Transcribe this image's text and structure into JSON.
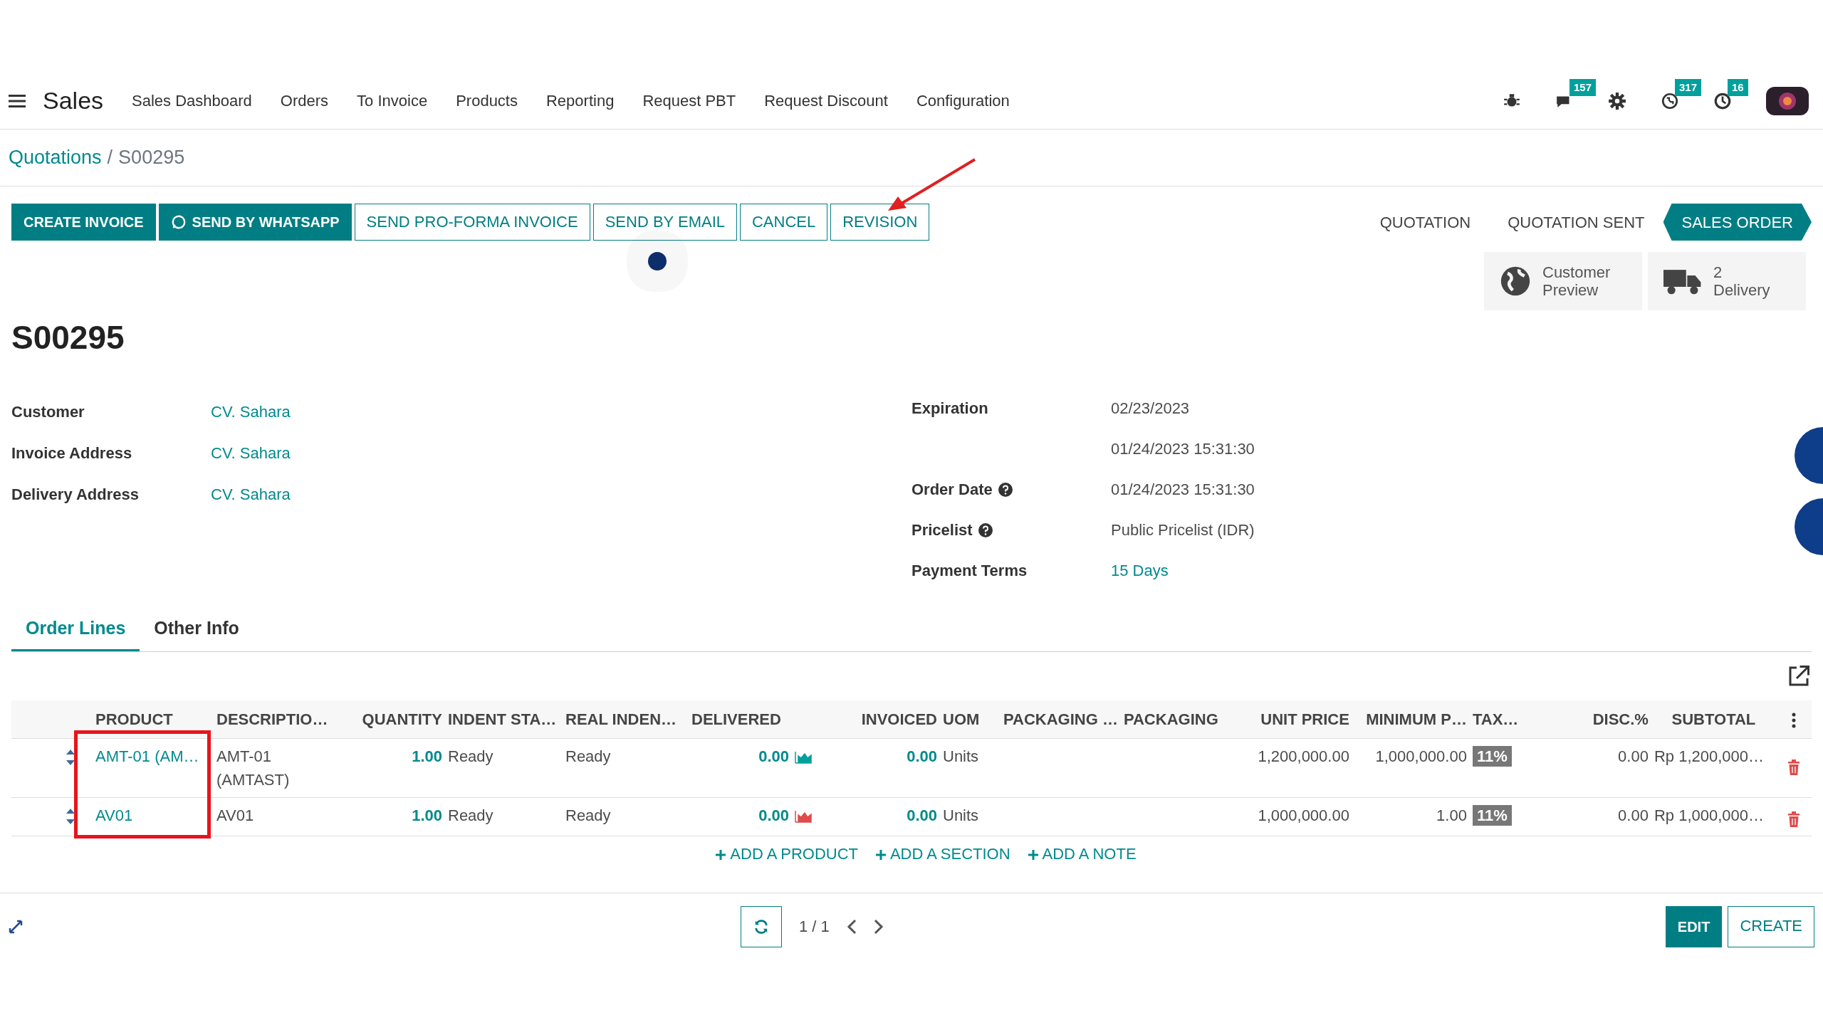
{
  "navbar": {
    "app_title": "Sales",
    "menu": [
      "Sales Dashboard",
      "Orders",
      "To Invoice",
      "Products",
      "Reporting",
      "Request PBT",
      "Request Discount",
      "Configuration"
    ],
    "systray": [
      {
        "kind": "bug"
      },
      {
        "kind": "chat",
        "badge": "157"
      },
      {
        "kind": "gear"
      },
      {
        "kind": "whatsapp",
        "badge": "317"
      },
      {
        "kind": "clock",
        "badge": "16"
      },
      {
        "kind": "avatar"
      }
    ]
  },
  "breadcrumb": {
    "parent": "Quotations",
    "separator": "/",
    "current": "S00295"
  },
  "action_buttons": [
    {
      "label": "CREATE INVOICE",
      "kind": "primary"
    },
    {
      "label": "SEND BY WHATSAPP",
      "kind": "whatsapp"
    },
    {
      "label": "SEND PRO-FORMA INVOICE",
      "kind": "secondary"
    },
    {
      "label": "SEND BY EMAIL",
      "kind": "secondary"
    },
    {
      "label": "CANCEL",
      "kind": "secondary"
    },
    {
      "label": "REVISION",
      "kind": "secondary"
    }
  ],
  "status_steps": [
    {
      "label": "QUOTATION",
      "selected": false
    },
    {
      "label": "QUOTATION SENT",
      "selected": false
    },
    {
      "label": "SALES ORDER",
      "selected": true
    }
  ],
  "smart_buttons": [
    {
      "kind": "globe",
      "lines": [
        "Customer",
        "Preview"
      ]
    },
    {
      "kind": "truck",
      "lines": [
        "2",
        "Delivery"
      ]
    }
  ],
  "title": "S00295",
  "fields_left": [
    {
      "label": "Customer",
      "value": "CV. Sahara",
      "link": true
    },
    {
      "label": "Invoice Address",
      "value": "CV. Sahara",
      "link": true
    },
    {
      "label": "Delivery Address",
      "value": "CV. Sahara",
      "link": true
    }
  ],
  "fields_right": [
    {
      "label": "Expiration",
      "value": "02/23/2023",
      "link": false,
      "help": false
    },
    {
      "value": "01/24/2023 15:31:30",
      "link": false,
      "help": false
    },
    {
      "label": "Order Date",
      "value": "01/24/2023 15:31:30",
      "link": false,
      "help": true
    },
    {
      "label": "Pricelist",
      "value": "Public Pricelist (IDR)",
      "link": false,
      "help": true
    },
    {
      "label": "Payment Terms",
      "value": "15 Days",
      "link": true,
      "help": false
    }
  ],
  "tabs": [
    {
      "label": "Order Lines",
      "selected": true
    },
    {
      "label": "Other Info",
      "selected": false
    }
  ],
  "table": {
    "columns": [
      "PRODUCT",
      "DESCRIPTIO…",
      "QUANTITY",
      "INDENT STA…",
      "REAL INDEN…",
      "DELIVERED",
      "INVOICED",
      "UOM",
      "PACKAGING …",
      "PACKAGING",
      "UNIT PRICE",
      "MINIMUM P…",
      "TAX…",
      "DISC.%",
      "SUBTOTAL"
    ],
    "rows": [
      {
        "product": "AMT-01 (AM…",
        "description": "AMT-01 (AMTAST)",
        "quantity": "1.00",
        "indent_status": "Ready",
        "real_indent": "Ready",
        "delivered": "0.00",
        "color": "#00a09d",
        "invoiced": "0.00",
        "uom": "Units",
        "unit_price": "1,200,000.00",
        "minimum_price": "1,000,000.00",
        "tax": "11%",
        "discount": "0.00",
        "subtotal": "Rp 1,200,000…"
      },
      {
        "product": "AV01",
        "description": "AV01",
        "quantity": "1.00",
        "indent_status": "Ready",
        "real_indent": "Ready",
        "delivered": "0.00",
        "color": "#e04b4b",
        "invoiced": "0.00",
        "uom": "Units",
        "unit_price": "1,000,000.00",
        "minimum_price": "1.00",
        "tax": "11%",
        "discount": "0.00",
        "subtotal": "Rp 1,000,000…"
      }
    ],
    "add_links": [
      "ADD A PRODUCT",
      "ADD A SECTION",
      "ADD A NOTE"
    ]
  },
  "pager": "1 / 1",
  "bottom_buttons": [
    {
      "label": "EDIT",
      "kind": "primary"
    },
    {
      "label": "CREATE",
      "kind": "secondary"
    }
  ]
}
